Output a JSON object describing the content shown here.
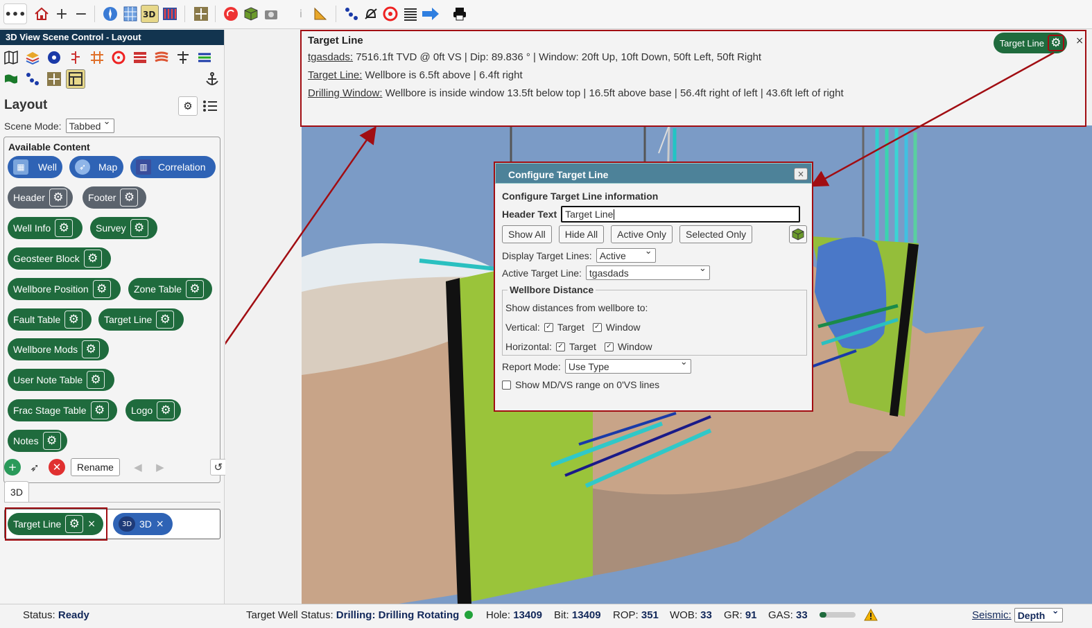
{
  "toolbar": {
    "more": "•••",
    "icons": [
      "home-icon",
      "zoom-in-icon",
      "zoom-out-icon",
      "compass-icon",
      "grid-icon",
      "3d-view-icon",
      "correlation-icon",
      "crosshair-icon",
      "refresh-icon",
      "cube-icon",
      "camera-icon",
      "info-icon",
      "ruler-icon",
      "points-icon",
      "alarm-icon",
      "target-icon",
      "list-icon",
      "arrow-right-icon",
      "print-icon"
    ]
  },
  "left": {
    "title": "3D View Scene Control - Layout",
    "layout_heading": "Layout",
    "scene_mode_label": "Scene Mode:",
    "scene_mode_value": "Tabbed",
    "available_content": "Available Content",
    "chips": [
      {
        "label": "Well"
      },
      {
        "label": "Map"
      },
      {
        "label": "Correlation"
      },
      {
        "label": "Header"
      },
      {
        "label": "Footer"
      },
      {
        "label": "Well Info"
      },
      {
        "label": "Survey"
      },
      {
        "label": "Geosteer Block"
      },
      {
        "label": "Wellbore Position"
      },
      {
        "label": "Zone Table"
      },
      {
        "label": "Fault Table"
      },
      {
        "label": "Target Line"
      },
      {
        "label": "Wellbore Mods"
      },
      {
        "label": "User Note Table"
      },
      {
        "label": "Frac Stage Table"
      },
      {
        "label": "Logo"
      },
      {
        "label": "Notes"
      }
    ],
    "rename": "Rename",
    "tab": "3D",
    "placed": {
      "target_line": "Target Line",
      "three_d": "3D",
      "three_d_badge": "3D",
      "close": "×"
    }
  },
  "header_box": {
    "title": "Target Line",
    "line1_link": "tgasdads:",
    "line1_text": " 7516.1ft TVD @ 0ft VS | Dip: 89.836 ° | Window: 20ft Up, 10ft Down, 50ft Left, 50ft Right",
    "line2_link": "Target Line:",
    "line2_text": " Wellbore is 6.5ft above | 6.4ft right",
    "line3_link": "Drilling Window:",
    "line3_text": " Wellbore is inside window 13.5ft below top | 16.5ft above base | 56.4ft right of left | 43.6ft left of right",
    "pill_label": "Target Line",
    "close": "×"
  },
  "dialog": {
    "title": "Configure Target Line",
    "close": "×",
    "subtitle": "Configure Target Line information",
    "header_text_label": "Header Text",
    "header_text_value": "Target Line",
    "buttons": [
      "Show All",
      "Hide All",
      "Active Only",
      "Selected Only"
    ],
    "display_label": "Display Target Lines:",
    "display_value": "Active",
    "active_label": "Active Target Line:",
    "active_value": "tgasdads",
    "wellbore_distance": "Wellbore Distance",
    "show_distances": "Show distances from wellbore to:",
    "vertical": "Vertical:",
    "horizontal": "Horizontal:",
    "target": "Target",
    "window": "Window",
    "report_label": "Report Mode:",
    "report_value": "Use Type",
    "show_md": "Show MD/VS range on 0'VS lines"
  },
  "status": {
    "status_label": "Status:",
    "status_value": "Ready",
    "target_label": "Target Well Status:",
    "target_value": "Drilling: Drilling Rotating",
    "hole_label": "Hole:",
    "hole_value": "13409",
    "bit_label": "Bit:",
    "bit_value": "13409",
    "rop_label": "ROP:",
    "rop_value": "351",
    "wob_label": "WOB:",
    "wob_value": "33",
    "gr_label": "GR:",
    "gr_value": "91",
    "gas_label": "GAS:",
    "gas_value": "33",
    "seismic_label": "Seismic:",
    "seismic_value": "Depth"
  },
  "colors": {
    "accent_green": "#1f6b3d",
    "accent_blue": "#2f63b5",
    "highlight_red": "#a10d12",
    "status_ok": "#22a33a"
  }
}
